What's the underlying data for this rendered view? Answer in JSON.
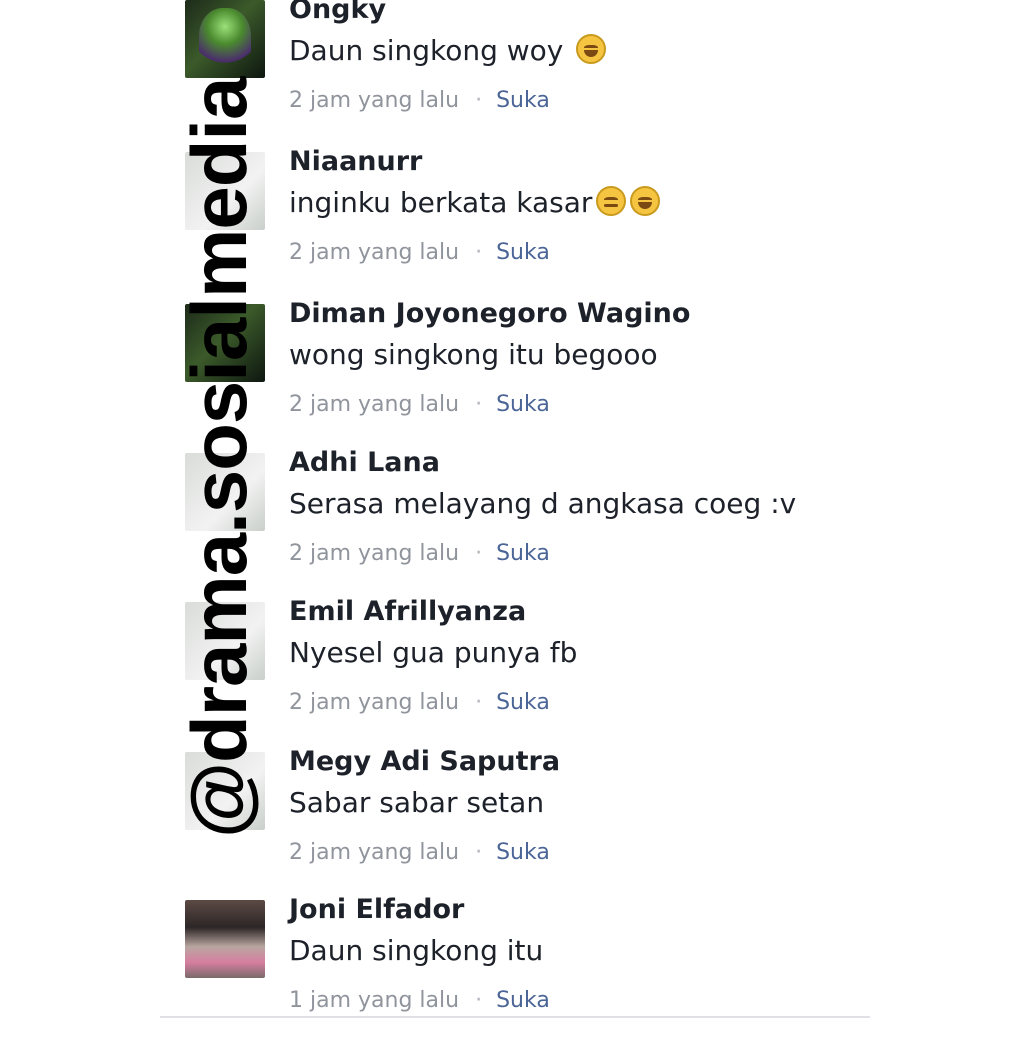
{
  "watermark": "@drama.sosialmedia",
  "comments": [
    {
      "name": "Ongky",
      "text": "Daun singkong woy",
      "emoji": "tears-of-joy-emoji",
      "time": "2 jam yang lalu",
      "like": "Suka"
    },
    {
      "name": "Niaanurr",
      "text": "inginku berkata kasar",
      "emoji": "smirk-and-tears-of-joy-emoji",
      "time": "2 jam yang lalu",
      "like": "Suka"
    },
    {
      "name": "Diman Joyonegoro Wagino",
      "text": "wong singkong itu begooo",
      "time": "2 jam yang lalu",
      "like": "Suka"
    },
    {
      "name": "Adhi Lana",
      "text": "Serasa melayang d angkasa coeg :v",
      "time": "2 jam yang lalu",
      "like": "Suka"
    },
    {
      "name": "Emil Afrillyanza",
      "text": "Nyesel gua punya fb",
      "time": "2 jam yang lalu",
      "like": "Suka"
    },
    {
      "name": "Megy Adi Saputra",
      "text": "Sabar sabar setan",
      "time": "2 jam yang lalu",
      "like": "Suka"
    },
    {
      "name": "Joni Elfador",
      "text": "Daun singkong itu",
      "time": "1 jam yang lalu",
      "like": "Suka"
    }
  ],
  "colors": {
    "name": "#1d2129",
    "meta": "#90949c",
    "like": "#4b6596",
    "watermark": "#000000"
  }
}
